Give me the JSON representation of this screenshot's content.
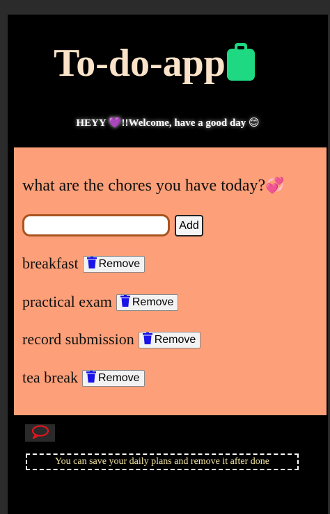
{
  "app": {
    "title": "To-do-app",
    "title_icon": "clipboard-icon",
    "accent_color": "#1ed882"
  },
  "welcome": {
    "text_before": "HEYY ",
    "heart_emoji": "💜",
    "text_after": "!!Welcome, have a good day ",
    "smile_emoji": "😊"
  },
  "panel": {
    "background": "#fd9f78",
    "question": "what are the chores you have today?",
    "question_emoji": "💞",
    "input": {
      "value": "",
      "placeholder": ""
    },
    "add_label": "Add",
    "remove_label": "Remove",
    "remove_icon": "trash-bin-icon",
    "tasks": [
      {
        "text": "breakfast"
      },
      {
        "text": "practical exam"
      },
      {
        "text": "record submission"
      },
      {
        "text": "tea break"
      }
    ]
  },
  "footer": {
    "chat_icon": "speech-bubble-icon",
    "note": "You can save your daily plans and remove it after done"
  }
}
